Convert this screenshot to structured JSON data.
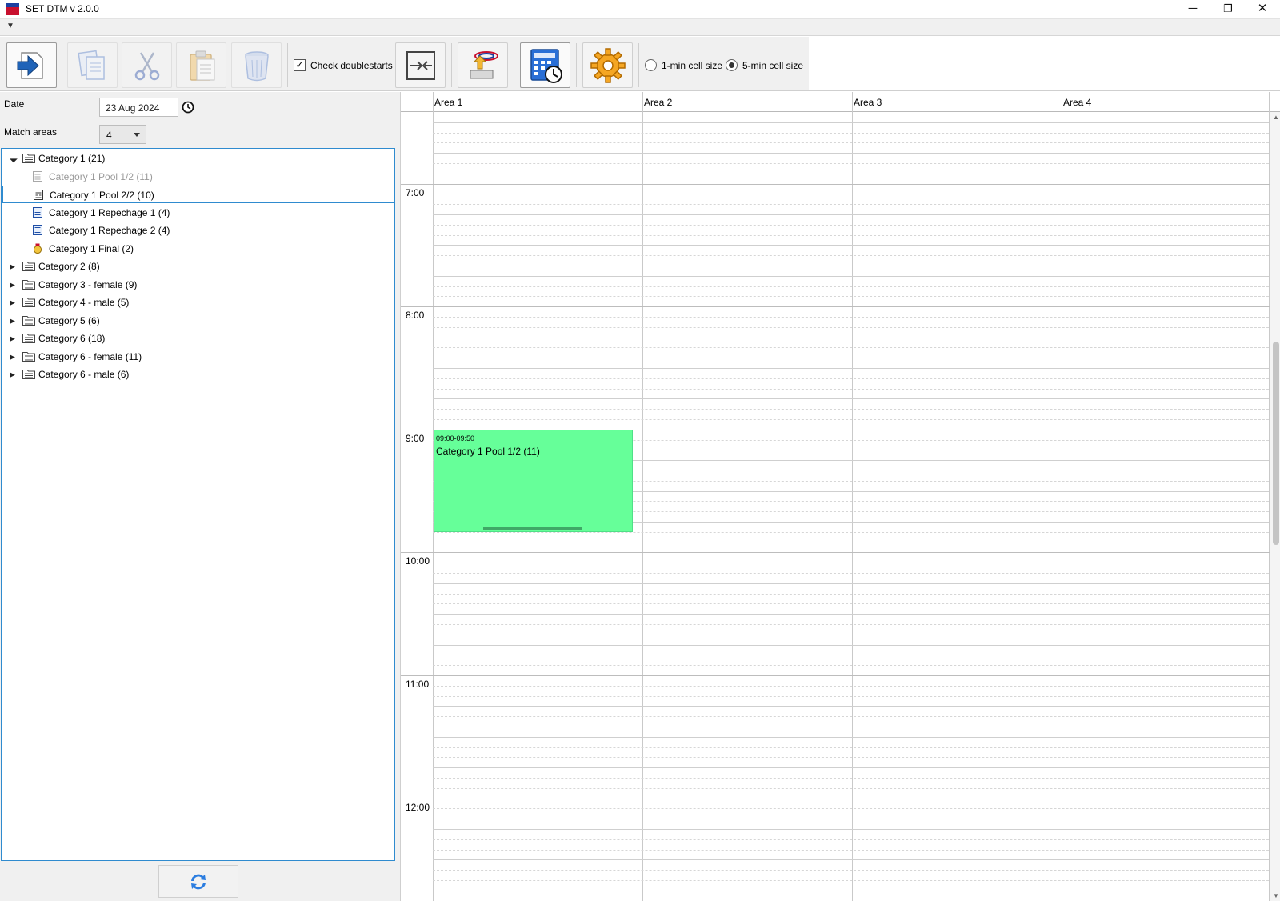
{
  "window": {
    "title": "SET DTM v 2.0.0",
    "minimize": "─",
    "maximize": "❐",
    "close": "✕"
  },
  "menu": {
    "expander": "▼"
  },
  "toolbar": {
    "check_doublestarts_label": "Check doublestarts",
    "check_doublestarts_checked": true,
    "check_mark": "✓",
    "cell_size_1_label": "1-min cell size",
    "cell_size_5_label": "5-min cell size",
    "selected_cell_size": "5-min"
  },
  "form": {
    "date_label": "Date",
    "date_value": "23 Aug 2024",
    "match_areas_label": "Match areas",
    "match_areas_value": "4"
  },
  "tree": {
    "expanded_glyph": "◢",
    "collapsed_glyph": "▶",
    "items": [
      {
        "label": "Category 1 (21)",
        "type": "folder",
        "expanded": true
      },
      {
        "label": "Category 1 Pool 1/2 (11)",
        "type": "pool",
        "dimmed": true
      },
      {
        "label": "Category 1 Pool 2/2 (10)",
        "type": "pool",
        "selected": true
      },
      {
        "label": "Category 1 Repechage 1 (4)",
        "type": "repechage"
      },
      {
        "label": "Category 1 Repechage 2 (4)",
        "type": "repechage"
      },
      {
        "label": "Category 1 Final (2)",
        "type": "final"
      },
      {
        "label": "Category 2 (8)",
        "type": "folder"
      },
      {
        "label": "Category 3 - female (9)",
        "type": "folder"
      },
      {
        "label": "Category 4 - male (5)",
        "type": "folder"
      },
      {
        "label": "Category 5 (6)",
        "type": "folder"
      },
      {
        "label": "Category 6 (18)",
        "type": "folder"
      },
      {
        "label": "Category 6 - female (11)",
        "type": "folder"
      },
      {
        "label": "Category 6 - male (6)",
        "type": "folder"
      }
    ]
  },
  "schedule": {
    "areas": [
      "Area 1",
      "Area 2",
      "Area 3",
      "Area 4"
    ],
    "hours": [
      "7:00",
      "8:00",
      "9:00",
      "10:00",
      "11:00",
      "12:00"
    ],
    "first_visible_hour": 6.4167,
    "event": {
      "time": "09:00-09:50",
      "title": "Category 1 Pool 1/2 (11)",
      "area": "Area 1",
      "start_hour": 9.0,
      "duration_min": 50,
      "color": "#66ff99"
    }
  },
  "colors": {
    "accent": "#2f8bcf",
    "event": "#66ff99",
    "dim_text": "#9a9a9a"
  }
}
